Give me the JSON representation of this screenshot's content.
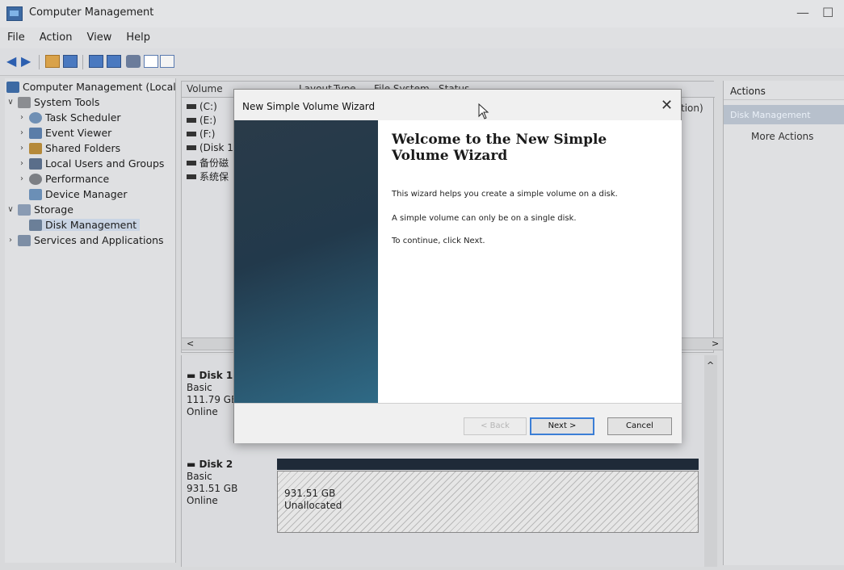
{
  "window": {
    "title": "Computer Management",
    "minimize": "—",
    "maximize": "☐"
  },
  "menu": [
    "File",
    "Action",
    "View",
    "Help"
  ],
  "tree": {
    "root": "Computer Management (Local",
    "system_tools": "System Tools",
    "task_scheduler": "Task Scheduler",
    "event_viewer": "Event Viewer",
    "shared_folders": "Shared Folders",
    "local_users": "Local Users and Groups",
    "performance": "Performance",
    "device_manager": "Device Manager",
    "storage": "Storage",
    "disk_management": "Disk Management",
    "services": "Services and Applications"
  },
  "volumes": {
    "headers": {
      "volume": "Volume",
      "layout": "Layout",
      "type": "Type",
      "fs": "File System",
      "status": "Status",
      "tail": "tion)"
    },
    "rows": [
      "(C:)",
      "(E:)",
      "(F:)",
      "(Disk 1",
      "备份磁",
      "系统保"
    ]
  },
  "disks": {
    "disk1": {
      "name": "Disk 1",
      "type": "Basic",
      "size": "111.79 GB",
      "state": "Online"
    },
    "disk2": {
      "name": "Disk 2",
      "type": "Basic",
      "size": "931.51 GB",
      "state": "Online",
      "part_size": "931.51 GB",
      "part_state": "Unallocated"
    }
  },
  "actions": {
    "header": "Actions",
    "selected": "Disk Management",
    "more": "More Actions"
  },
  "wizard": {
    "title": "New Simple Volume Wizard",
    "close": "✕",
    "heading": "Welcome to the New Simple Volume Wizard",
    "line1": "This wizard helps you create a simple volume on a disk.",
    "line2": "A simple volume can only be on a single disk.",
    "line3": "To continue, click Next.",
    "back": "< Back",
    "next": "Next >",
    "cancel": "Cancel"
  },
  "scroll": {
    "left": "<",
    "right": ">",
    "up": "^"
  }
}
